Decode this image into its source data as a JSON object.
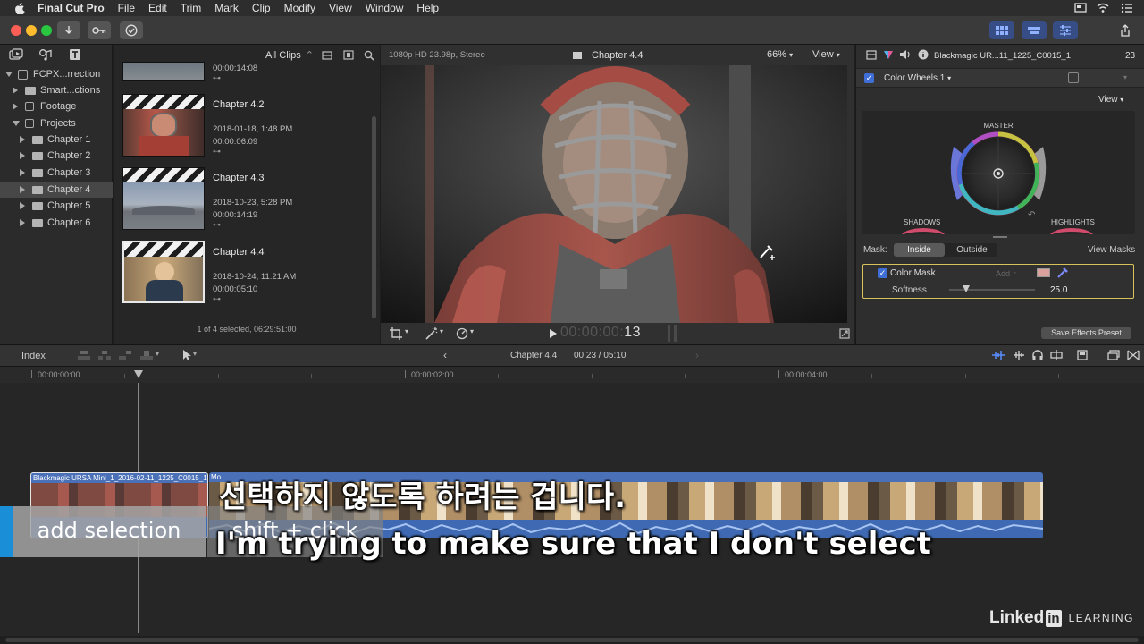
{
  "menu": {
    "app": "Final Cut Pro",
    "items": [
      "File",
      "Edit",
      "Trim",
      "Mark",
      "Clip",
      "Modify",
      "View",
      "Window",
      "Help"
    ]
  },
  "library": {
    "root": "FCPX...rrection",
    "items": [
      {
        "label": "Smart...ctions"
      },
      {
        "label": "Footage"
      },
      {
        "label": "Projects"
      },
      {
        "label": "Chapter 1"
      },
      {
        "label": "Chapter 2"
      },
      {
        "label": "Chapter 3"
      },
      {
        "label": "Chapter 4"
      },
      {
        "label": "Chapter 5"
      },
      {
        "label": "Chapter 6"
      }
    ]
  },
  "browser": {
    "filter": "All Clips",
    "partial_clip_duration": "00:00:14:08",
    "clips": [
      {
        "title": "Chapter 4.2",
        "date": "2018-01-18, 1:48 PM",
        "duration": "00:00:06:09"
      },
      {
        "title": "Chapter 4.3",
        "date": "2018-10-23, 5:28 PM",
        "duration": "00:00:14:19"
      },
      {
        "title": "Chapter 4.4",
        "date": "2018-10-24, 11:21 AM",
        "duration": "00:00:05:10"
      }
    ],
    "status": "1 of 4 selected, 06:29:51:00"
  },
  "viewer": {
    "format": "1080p HD 23.98p, Stereo",
    "title": "Chapter 4.4",
    "zoom": "66%",
    "view": "View",
    "timecode_dim": "00:00:00:",
    "timecode_frame": "13"
  },
  "inspector": {
    "clip_name": "Blackmagic UR...11_1225_C0015_1",
    "frame_num": "23",
    "effect": "Color Wheels 1",
    "view": "View",
    "master": "MASTER",
    "shadows": "SHADOWS",
    "highlights": "HIGHLIGHTS",
    "mask_label": "Mask:",
    "inside": "Inside",
    "outside": "Outside",
    "view_masks": "View Masks",
    "color_mask": "Color Mask",
    "add": "Add",
    "softness": "Softness",
    "softness_value": "25.0",
    "save_preset": "Save Effects Preset"
  },
  "timeline": {
    "index": "Index",
    "project": "Chapter 4.4",
    "position": "00:23 / 05:10",
    "ruler": [
      "00:00:00:00",
      "00:00:02:00",
      "00:00:04:00"
    ],
    "clip1_name": "Blackmagic URSA Mini_1_2016-02-11_1225_C0015_1",
    "clip2_name": "Mo"
  },
  "overlay": {
    "action": "add selection",
    "shortcut": "shift + click",
    "subtitle_ko": "선택하지 않도록 하려는 겁니다.",
    "subtitle_en": "I'm trying to make sure that I don't select",
    "brand": "Linked",
    "brand_in": "in",
    "brand_learning": "LEARNING"
  },
  "colors": {
    "accent_blue": "#3f6fd6",
    "selection_yellow": "#d8c35a",
    "clip_blue": "#4a70b8",
    "shortcut_blue": "#1a8fd8"
  }
}
